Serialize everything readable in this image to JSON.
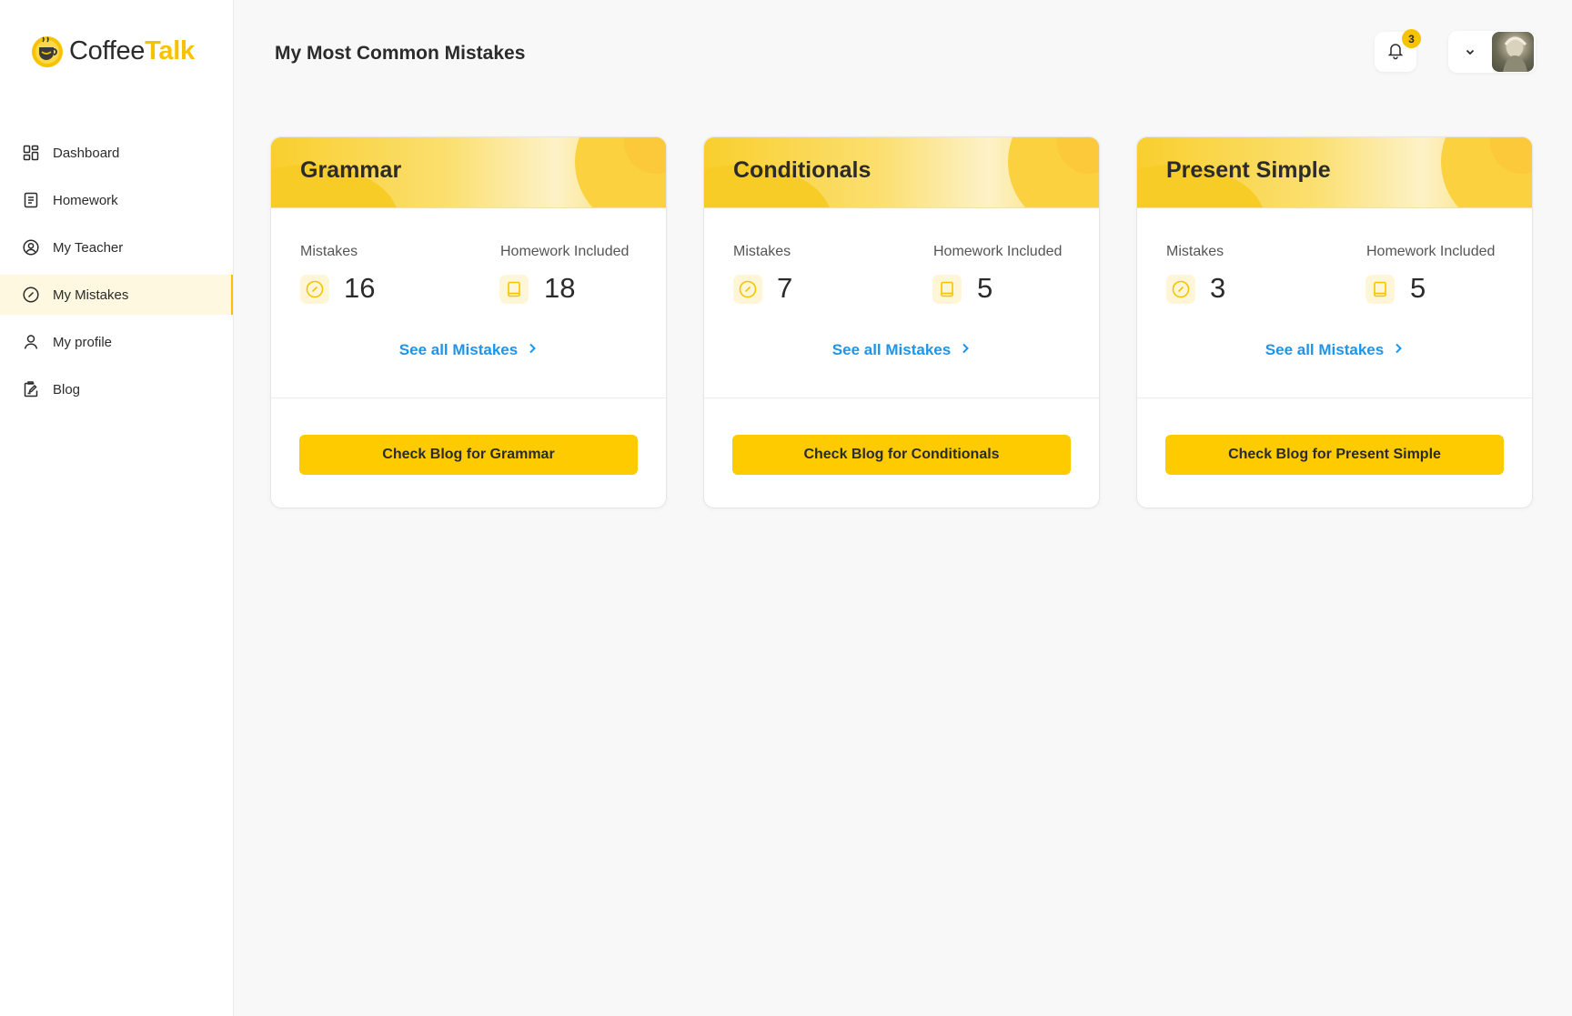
{
  "app": {
    "logo_part1": "Coffee",
    "logo_part2": "Talk"
  },
  "sidebar": {
    "items": [
      {
        "label": "Dashboard",
        "icon": "dashboard-icon"
      },
      {
        "label": "Homework",
        "icon": "document-icon"
      },
      {
        "label": "My Teacher",
        "icon": "user-circle-icon"
      },
      {
        "label": "My Mistakes",
        "icon": "check-circle-icon",
        "active": true
      },
      {
        "label": "My profile",
        "icon": "user-icon"
      },
      {
        "label": "Blog",
        "icon": "blog-edit-icon"
      }
    ]
  },
  "header": {
    "title": "My Most Common Mistakes",
    "notification_count": "3"
  },
  "cards": [
    {
      "title": "Grammar",
      "mistakes_label": "Mistakes",
      "mistakes_value": "16",
      "homework_label": "Homework Included",
      "homework_value": "18",
      "see_all": "See all Mistakes",
      "button": "Check Blog for Grammar"
    },
    {
      "title": "Conditionals",
      "mistakes_label": "Mistakes",
      "mistakes_value": "7",
      "homework_label": "Homework Included",
      "homework_value": "5",
      "see_all": "See all Mistakes",
      "button": "Check Blog for Conditionals"
    },
    {
      "title": "Present Simple",
      "mistakes_label": "Mistakes",
      "mistakes_value": "3",
      "homework_label": "Homework Included",
      "homework_value": "5",
      "see_all": "See all Mistakes",
      "button": "Check Blog for Present Simple"
    }
  ],
  "colors": {
    "accent": "#fecb00",
    "link": "#1e95e8",
    "active_bg": "#fff8e0"
  }
}
